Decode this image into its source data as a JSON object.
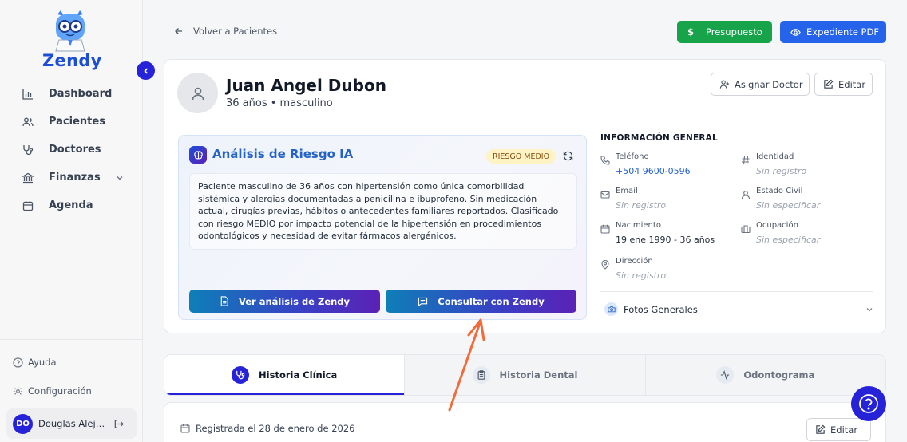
{
  "app": {
    "brand": "Zendy"
  },
  "sidebar": {
    "items": [
      {
        "label": "Dashboard",
        "icon": "chart-bar-icon"
      },
      {
        "label": "Pacientes",
        "icon": "users-icon"
      },
      {
        "label": "Doctores",
        "icon": "stethoscope-icon"
      },
      {
        "label": "Finanzas",
        "icon": "bank-icon"
      },
      {
        "label": "Agenda",
        "icon": "calendar-icon"
      }
    ],
    "help_label": "Ayuda",
    "settings_label": "Configuración",
    "user": {
      "initials": "DO",
      "name": "Douglas Alejandro"
    }
  },
  "header": {
    "back_label": "Volver a Pacientes",
    "budget_label": "Presupuesto",
    "budget_symbol": "$",
    "pdf_label": "Expediente PDF"
  },
  "patient": {
    "name": "Juan Angel Dubon",
    "subtitle": "36 años • masculino",
    "assign_label": "Asignar Doctor",
    "edit_label": "Editar"
  },
  "ai": {
    "title": "Análisis de Riesgo IA",
    "badge": "RIESGO MEDIO",
    "summary": "Paciente masculino de 36 años con hipertensión como única comorbilidad sistémica y alergias documentadas a penicilina e ibuprofeno. Sin medicación actual, cirugías previas, hábitos o antecedentes familiares reportados. Clasificado con riesgo MEDIO por impacto potencial de la hipertensión en procedimientos odontológicos y necesidad de evitar fármacos alergénicos.",
    "view_label": "Ver análisis de Zendy",
    "consult_label": "Consultar con Zendy"
  },
  "info": {
    "title": "INFORMACIÓN GENERAL",
    "phone": {
      "label": "Teléfono",
      "value": "+504 9600-0596"
    },
    "identity": {
      "label": "Identidad",
      "value": "Sin registro"
    },
    "email": {
      "label": "Email",
      "value": "Sin registro"
    },
    "civil": {
      "label": "Estado Civil",
      "value": "Sin especificar"
    },
    "birth": {
      "label": "Nacimiento",
      "value": "19 ene 1990 - 36 años"
    },
    "occupation": {
      "label": "Ocupación",
      "value": "Sin especificar"
    },
    "address": {
      "label": "Dirección",
      "value": "Sin registro"
    },
    "photos_label": "Fotos Generales"
  },
  "tabs": [
    {
      "label": "Historia Clínica",
      "icon": "stethoscope-icon",
      "active": true
    },
    {
      "label": "Historia Dental",
      "icon": "clipboard-icon",
      "active": false
    },
    {
      "label": "Odontograma",
      "icon": "activity-icon",
      "active": false
    }
  ],
  "history": {
    "registered": "Registrada el 28 de enero de 2026",
    "edit_label": "Editar"
  },
  "colors": {
    "primary": "#2522d8",
    "green": "#16a34a",
    "blue": "#2563eb",
    "annotation_arrow": "#f26b3a"
  }
}
